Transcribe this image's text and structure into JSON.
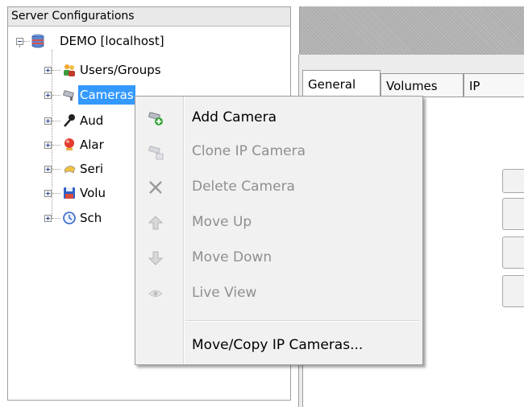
{
  "tree": {
    "header": "Server Configurations",
    "root": {
      "label": "DEMO [localhost]",
      "icon": "database-icon"
    },
    "items": [
      {
        "label": "Users/Groups",
        "icon": "users-icon",
        "selected": false
      },
      {
        "label": "Cameras",
        "icon": "camera-icon",
        "selected": true
      },
      {
        "label": "Aud",
        "icon": "microphone-icon",
        "selected": false
      },
      {
        "label": "Alar",
        "icon": "alarm-icon",
        "selected": false
      },
      {
        "label": "Seri",
        "icon": "serial-icon",
        "selected": false
      },
      {
        "label": "Volu",
        "icon": "floppy-disk-icon",
        "selected": false
      },
      {
        "label": "Sch",
        "icon": "clock-icon",
        "selected": false
      }
    ]
  },
  "tabs": [
    {
      "label": "General",
      "active": true
    },
    {
      "label": "Volumes",
      "active": false
    },
    {
      "label": "IP",
      "active": false
    }
  ],
  "context_menu": {
    "items": [
      {
        "label": "Add Camera",
        "icon": "add-camera-icon",
        "enabled": true
      },
      {
        "label": "Clone IP Camera",
        "icon": "clone-camera-icon",
        "enabled": false
      },
      {
        "label": "Delete Camera",
        "icon": "delete-x-icon",
        "enabled": false
      },
      {
        "label": "Move Up",
        "icon": "arrow-up-icon",
        "enabled": false
      },
      {
        "label": "Move Down",
        "icon": "arrow-down-icon",
        "enabled": false
      },
      {
        "label": "Live View",
        "icon": "eye-icon",
        "enabled": false
      },
      {
        "label": "Move/Copy IP Cameras...",
        "icon": "",
        "enabled": true
      }
    ]
  }
}
